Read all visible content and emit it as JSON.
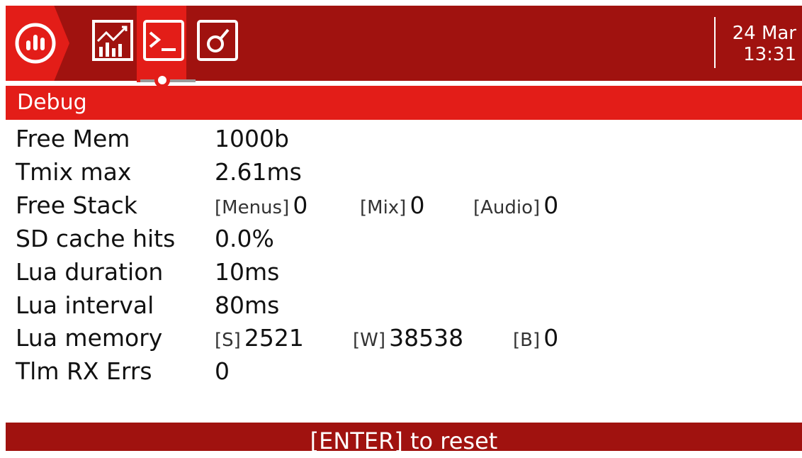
{
  "header": {
    "date": "24 Mar",
    "time": "13:31",
    "menu_icon": "radio-menu-icon",
    "tabs": [
      {
        "icon": "stats-chart-icon",
        "active": false
      },
      {
        "icon": "terminal-icon",
        "active": true
      },
      {
        "icon": "analog-input-icon",
        "active": false
      }
    ]
  },
  "page": {
    "title": "Debug"
  },
  "rows": {
    "free_mem": {
      "label": "Free Mem",
      "value": "1000b"
    },
    "tmix_max": {
      "label": "Tmix max",
      "value": "2.61ms"
    },
    "free_stack": {
      "label": "Free Stack",
      "menus_tag": "[Menus]",
      "menus_value": "0",
      "mix_tag": "[Mix]",
      "mix_value": "0",
      "audio_tag": "[Audio]",
      "audio_value": "0"
    },
    "sd_cache": {
      "label": "SD cache hits",
      "value": "0.0%"
    },
    "lua_duration": {
      "label": "Lua duration",
      "value": "10ms"
    },
    "lua_interval": {
      "label": "Lua interval",
      "value": "80ms"
    },
    "lua_memory": {
      "label": "Lua memory",
      "s_tag": "[S]",
      "s_value": "2521",
      "w_tag": "[W]",
      "w_value": "38538",
      "b_tag": "[B]",
      "b_value": "0"
    },
    "tlm_rx": {
      "label": "Tlm RX Errs",
      "value": "0"
    }
  },
  "footer": {
    "reset_label": "[ENTER] to reset"
  },
  "colors": {
    "dark_red": "#a0120f",
    "bright_red": "#e31d18",
    "white": "#ffffff"
  }
}
